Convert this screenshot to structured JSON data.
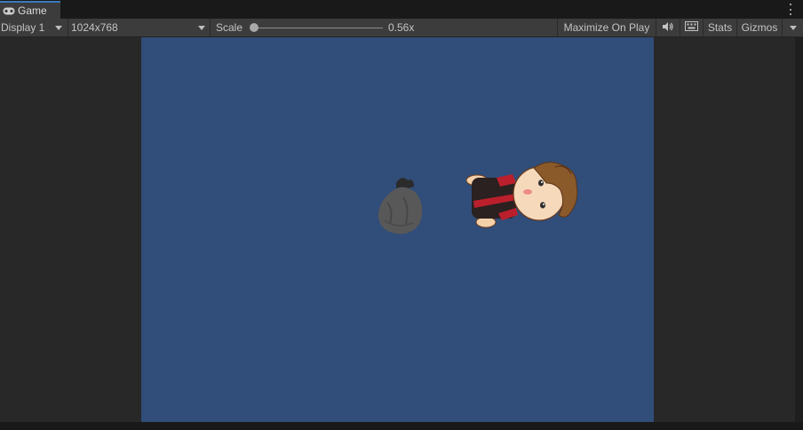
{
  "tab": {
    "title": "Game",
    "icon": "gamepad-icon"
  },
  "toolbar": {
    "display": "Display 1",
    "resolution": "1024x768",
    "scale_label": "Scale",
    "scale_value": "0.56x",
    "scale_fraction": 0.0,
    "maximize_on_play": "Maximize On Play",
    "mute_icon": "speaker-icon",
    "keyboard_icon": "keyboard-icon",
    "stats": "Stats",
    "gizmos": "Gizmos"
  },
  "game_view": {
    "background_color": "#314d79",
    "sprites": [
      "trash-bag-sprite",
      "boy-character-sprite"
    ]
  }
}
